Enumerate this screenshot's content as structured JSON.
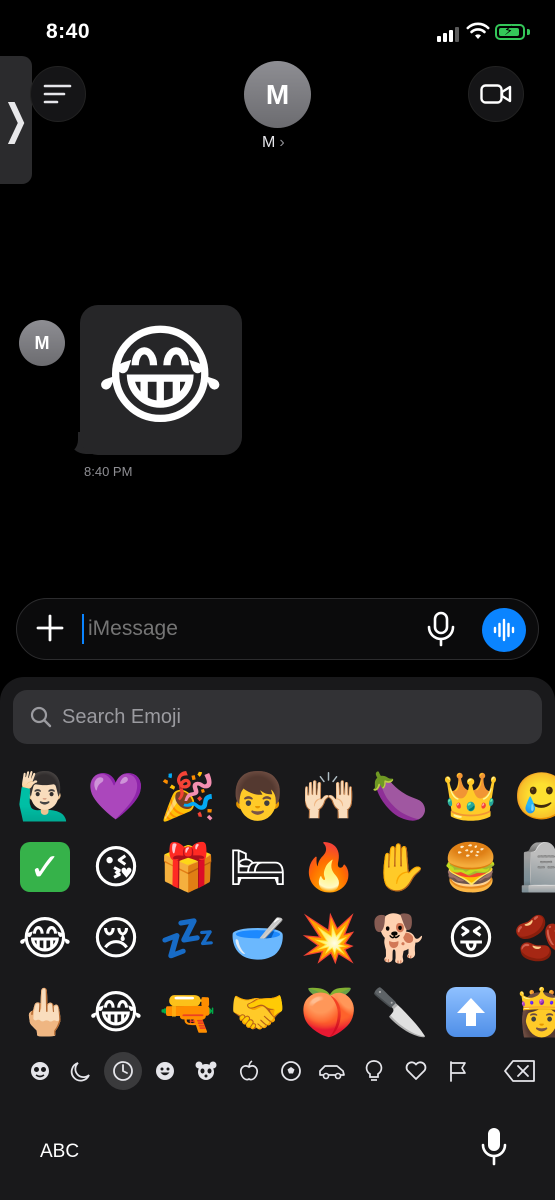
{
  "status_bar": {
    "time": "8:40"
  },
  "header": {
    "contact_initial": "M",
    "contact_name": "M",
    "chevron": "›"
  },
  "conversation": {
    "sender_initial": "M",
    "message_emoji": "😂",
    "message_time": "8:40 PM"
  },
  "input": {
    "placeholder": "iMessage"
  },
  "emoji_keyboard": {
    "search_placeholder": "Search Emoji",
    "row1": [
      "🙋🏻‍♂️",
      "💜",
      "🎉",
      "👦",
      "🙌🏻",
      "🍆",
      "👑",
      "🥲"
    ],
    "row2": [
      "✅",
      "😘",
      "🎁",
      "🛏",
      "🔥",
      "✋",
      "🍔",
      "🪦"
    ],
    "row3": [
      "😂",
      "😢",
      "💤",
      "🥣",
      "💥",
      "🐕",
      "😝",
      "🫘"
    ],
    "row4": [
      "🖕🏻",
      "😂",
      "🔫",
      "🤝",
      "🍑",
      "🔪",
      "⬆️",
      "👸"
    ],
    "categories": [
      "emoji-stickers",
      "moon",
      "recents",
      "smileys",
      "animals",
      "food",
      "activity",
      "travel",
      "objects",
      "symbols",
      "flags"
    ],
    "abc_label": "ABC"
  },
  "colors": {
    "accent": "#0a84ff",
    "battery": "#34c759"
  }
}
